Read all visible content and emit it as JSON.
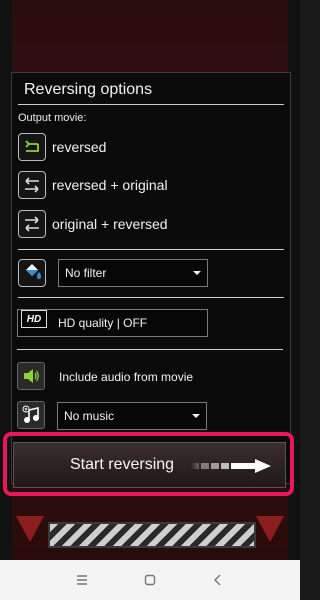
{
  "dialog": {
    "title": "Reversing options",
    "output_label": "Output movie:",
    "options": [
      {
        "label": "reversed",
        "icon": "undo-arrow-icon"
      },
      {
        "label": "reversed + original",
        "icon": "reverse-forward-arrows-icon"
      },
      {
        "label": "original + reversed",
        "icon": "forward-reverse-arrows-icon"
      }
    ],
    "filter": {
      "value": "No filter"
    },
    "quality": {
      "badge": "HD",
      "value": "HD quality | OFF"
    },
    "audio": {
      "label": "Include audio from movie"
    },
    "music": {
      "value": "No music"
    }
  },
  "start_button": {
    "label": "Start reversing"
  },
  "colors": {
    "highlight": "#e8185a",
    "accent_green": "#8bd23a"
  }
}
